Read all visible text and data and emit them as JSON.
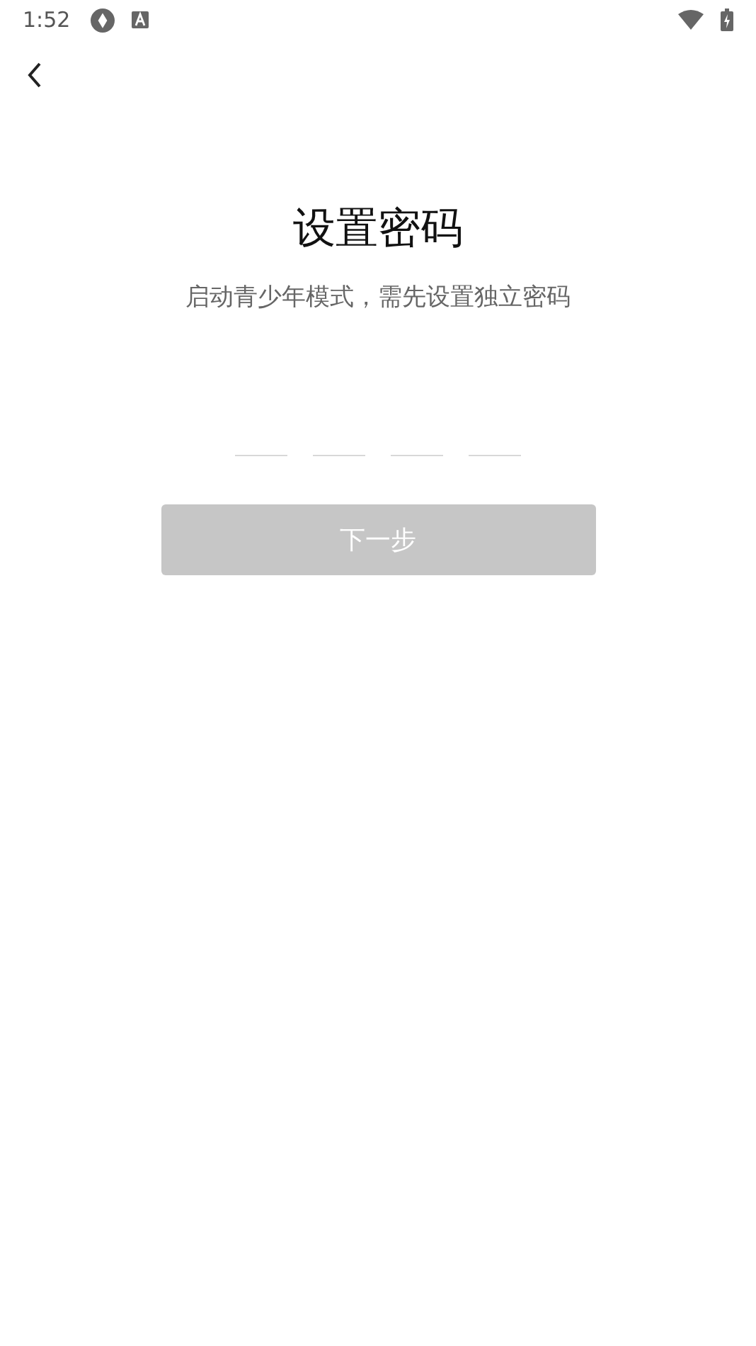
{
  "status_bar": {
    "time": "1:52"
  },
  "title": "设置密码",
  "subtitle": "启动青少年模式，需先设置独立密码",
  "pin_digits": [
    {
      "filled": false
    },
    {
      "filled": false
    },
    {
      "filled": false
    },
    {
      "filled": false
    }
  ],
  "next_button": {
    "label": "下一步",
    "disabled": true
  }
}
